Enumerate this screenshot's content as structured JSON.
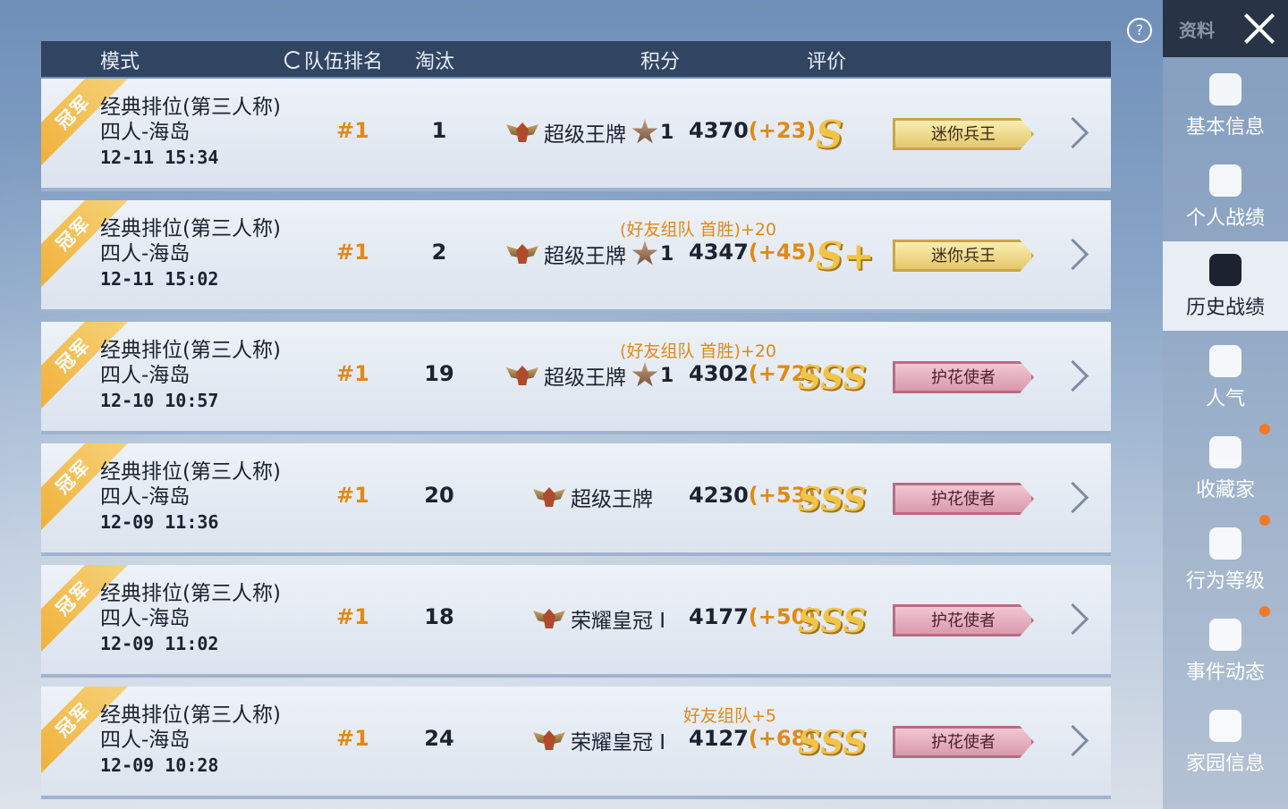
{
  "header": {
    "mode": "模式",
    "team_rank": "队伍排名",
    "kills": "淘汰",
    "score": "积分",
    "rating": "评价"
  },
  "help_label": "?",
  "sidebar": {
    "title": "资料",
    "items": [
      {
        "label": "基本信息",
        "icon": "profile-icon",
        "active": false
      },
      {
        "label": "个人战绩",
        "icon": "stats-icon",
        "active": false
      },
      {
        "label": "历史战绩",
        "icon": "history-icon",
        "active": true
      },
      {
        "label": "人气",
        "icon": "popularity-icon",
        "active": false
      },
      {
        "label": "收藏家",
        "icon": "collector-icon",
        "active": false
      },
      {
        "label": "行为等级",
        "icon": "behavior-icon",
        "active": false
      },
      {
        "label": "事件动态",
        "icon": "events-icon",
        "active": false
      },
      {
        "label": "家园信息",
        "icon": "home-icon",
        "active": false
      }
    ]
  },
  "matches": [
    {
      "ribbon": "冠军",
      "mode": "经典排位(第三人称)",
      "map": "四人-海岛",
      "date": "12-11 15:34",
      "rank": "#1",
      "kills": "1",
      "bonus": "",
      "tier": "超级王牌",
      "stars": "1",
      "score": "4370",
      "delta": "(+23)",
      "grade": "S",
      "badge": "迷你兵王",
      "badge_color": "gold"
    },
    {
      "ribbon": "冠军",
      "mode": "经典排位(第三人称)",
      "map": "四人-海岛",
      "date": "12-11 15:02",
      "rank": "#1",
      "kills": "2",
      "bonus": "(好友组队 首胜)+20",
      "tier": "超级王牌",
      "stars": "1",
      "score": "4347",
      "delta": "(+45)",
      "grade": "S+",
      "badge": "迷你兵王",
      "badge_color": "gold"
    },
    {
      "ribbon": "冠军",
      "mode": "经典排位(第三人称)",
      "map": "四人-海岛",
      "date": "12-10 10:57",
      "rank": "#1",
      "kills": "19",
      "bonus": "(好友组队 首胜)+20",
      "tier": "超级王牌",
      "stars": "1",
      "score": "4302",
      "delta": "(+72)",
      "grade": "SSS",
      "badge": "护花使者",
      "badge_color": "pink"
    },
    {
      "ribbon": "冠军",
      "mode": "经典排位(第三人称)",
      "map": "四人-海岛",
      "date": "12-09 11:36",
      "rank": "#1",
      "kills": "20",
      "bonus": "",
      "tier": "超级王牌",
      "stars": "",
      "score": "4230",
      "delta": "(+53)",
      "grade": "SSS",
      "badge": "护花使者",
      "badge_color": "pink"
    },
    {
      "ribbon": "冠军",
      "mode": "经典排位(第三人称)",
      "map": "四人-海岛",
      "date": "12-09 11:02",
      "rank": "#1",
      "kills": "18",
      "bonus": "",
      "tier": "荣耀皇冠 I",
      "stars": "",
      "score": "4177",
      "delta": "(+50)",
      "grade": "SSS",
      "badge": "护花使者",
      "badge_color": "pink"
    },
    {
      "ribbon": "冠军",
      "mode": "经典排位(第三人称)",
      "map": "四人-海岛",
      "date": "12-09 10:28",
      "rank": "#1",
      "kills": "24",
      "bonus": "好友组队+5",
      "tier": "荣耀皇冠 I",
      "stars": "",
      "score": "4127",
      "delta": "(+68)",
      "grade": "SSS",
      "badge": "护花使者",
      "badge_color": "pink"
    }
  ]
}
